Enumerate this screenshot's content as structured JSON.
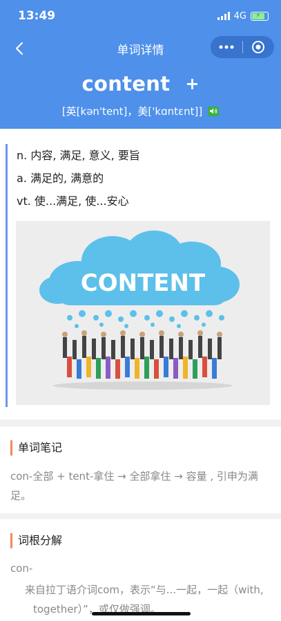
{
  "status": {
    "time": "13:49",
    "network": "4G"
  },
  "navbar": {
    "title": "单词详情"
  },
  "word": {
    "text": "content",
    "plus": "+",
    "phonetic": "[英[kən'tent]，美['kɑntɛnt]]"
  },
  "definitions": [
    "n. 内容, 满足, 意义, 要旨",
    "a. 满足的, 满意的",
    "vt. 使...满足, 使...安心"
  ],
  "image": {
    "text": "CONTENT"
  },
  "note": {
    "title": "单词笔记",
    "text": "con-全部 + tent-拿住 → 全部拿住 → 容量 , 引申为满足。"
  },
  "root": {
    "title": "词根分解",
    "prefix": "con-",
    "desc": "来自拉丁语介词com，表示“与...一起，一起（with, together）”，或仅做强调。"
  },
  "colors": {
    "header": "#4e90ea",
    "accent_left": "#6a97e8",
    "section_bar": "#f08a5d"
  }
}
